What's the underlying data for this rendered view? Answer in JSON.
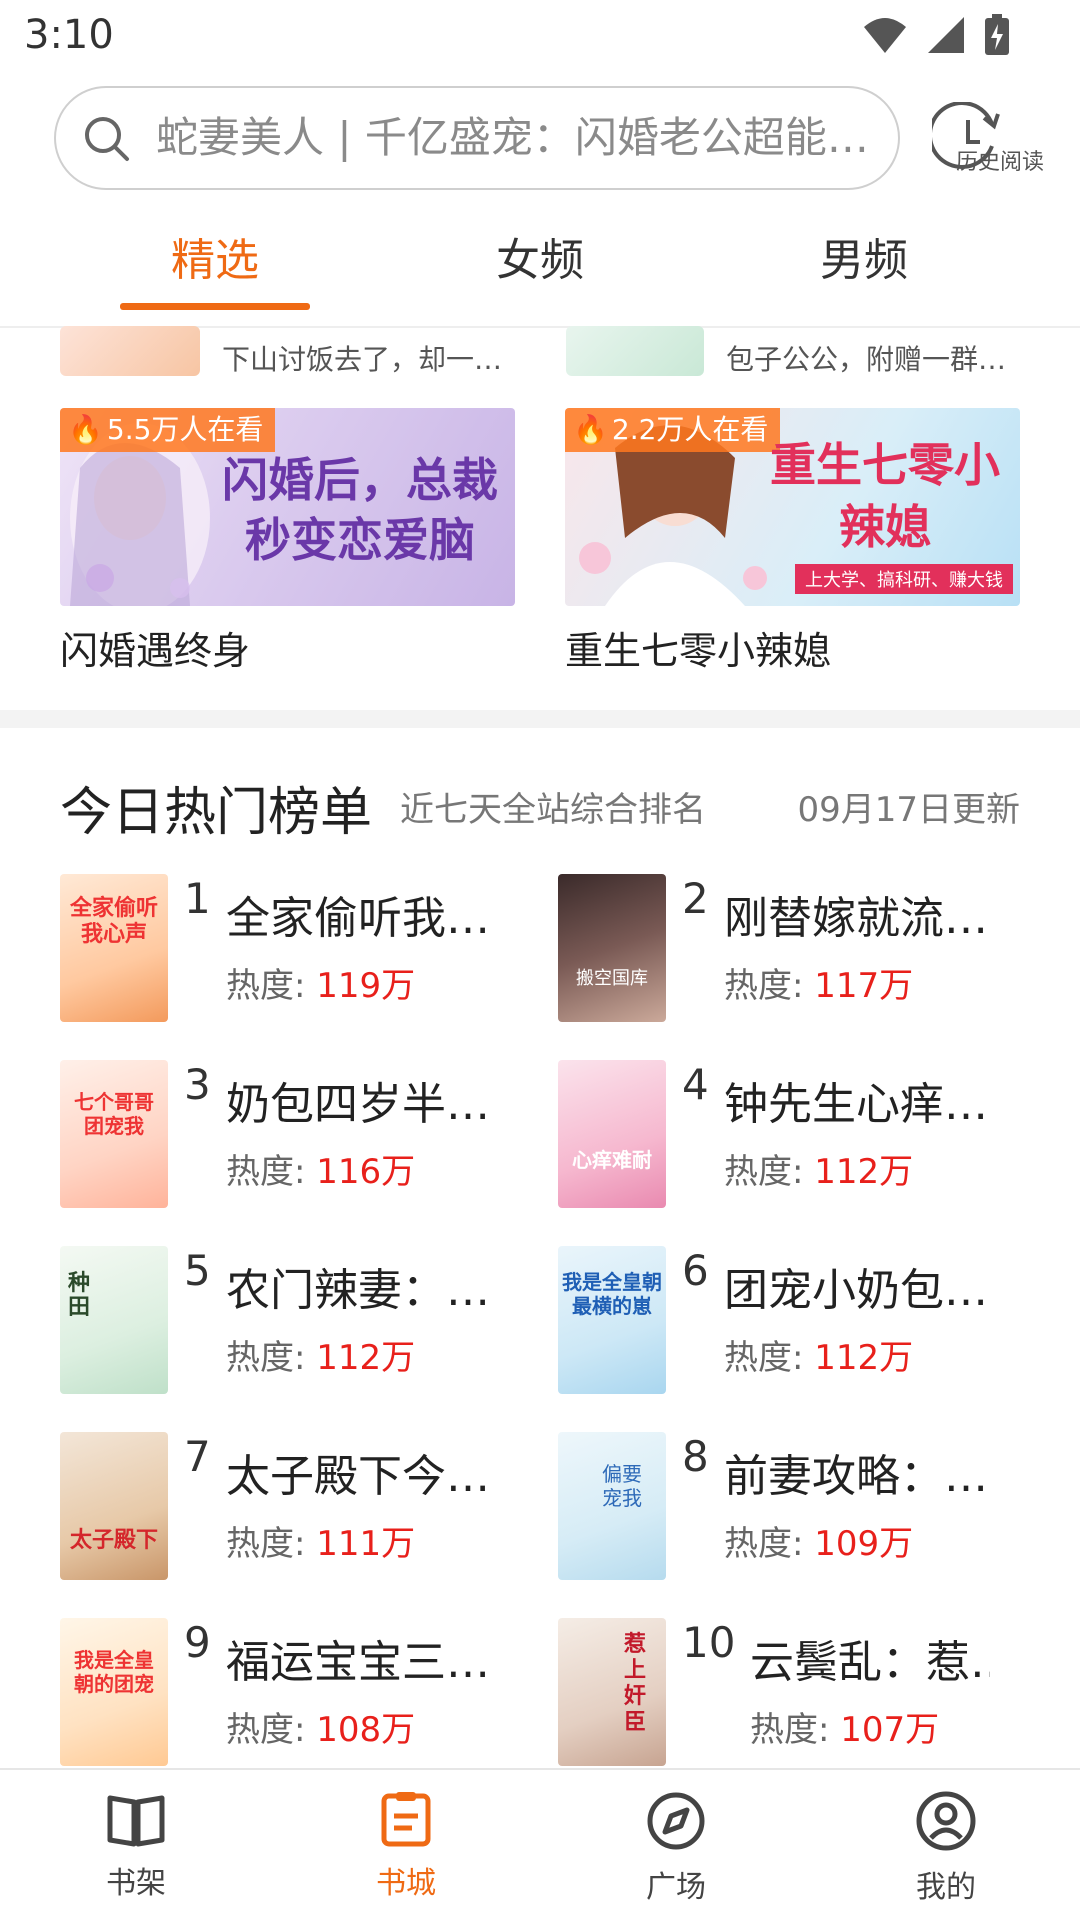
{
  "status": {
    "time": "3:10"
  },
  "search": {
    "placeholder": "蛇妻美人 | 千亿盛宠：闪婚老公超能…"
  },
  "history": {
    "label": "历史阅读"
  },
  "tabs": [
    {
      "label": "精选",
      "active": true
    },
    {
      "label": "女频",
      "active": false
    },
    {
      "label": "男频",
      "active": false
    }
  ],
  "top_cards": [
    {
      "text": "下山讨饭去了，却一…"
    },
    {
      "text": "包子公公，附赠一群…"
    }
  ],
  "banners": [
    {
      "watch": "5.5万人在看",
      "art_text": "闪婚后，总裁秒变恋爱脑",
      "label": "闪婚遇终身"
    },
    {
      "watch": "2.2万人在看",
      "art_text": "重生七零小辣媳",
      "art_sub": "上大学、搞科研、赚大钱",
      "label": "重生七零小辣媳"
    }
  ],
  "ranking": {
    "title": "今日热门榜单",
    "subtitle": "近七天全站综合排名",
    "date": "09月17日更新",
    "heat_label": "热度: ",
    "items": [
      {
        "rank": "1",
        "name": "全家偷听我…",
        "heat": "119万"
      },
      {
        "rank": "2",
        "name": "刚替嫁就流…",
        "heat": "117万"
      },
      {
        "rank": "3",
        "name": "奶包四岁半…",
        "heat": "116万"
      },
      {
        "rank": "4",
        "name": "钟先生心痒…",
        "heat": "112万"
      },
      {
        "rank": "5",
        "name": "农门辣妻：…",
        "heat": "112万"
      },
      {
        "rank": "6",
        "name": "团宠小奶包…",
        "heat": "112万"
      },
      {
        "rank": "7",
        "name": "太子殿下今…",
        "heat": "111万"
      },
      {
        "rank": "8",
        "name": "前妻攻略：…",
        "heat": "109万"
      },
      {
        "rank": "9",
        "name": "福运宝宝三…",
        "heat": "108万"
      },
      {
        "rank": "10",
        "name": "云鬓乱：惹…",
        "heat": "107万"
      }
    ]
  },
  "bottom_nav": [
    {
      "label": "书架",
      "icon": "book-open-icon",
      "active": false
    },
    {
      "label": "书城",
      "icon": "store-icon",
      "active": true
    },
    {
      "label": "广场",
      "icon": "compass-icon",
      "active": false
    },
    {
      "label": "我的",
      "icon": "profile-icon",
      "active": false
    }
  ],
  "colors": {
    "accent": "#ef6a14",
    "heat": "#e8201b"
  }
}
